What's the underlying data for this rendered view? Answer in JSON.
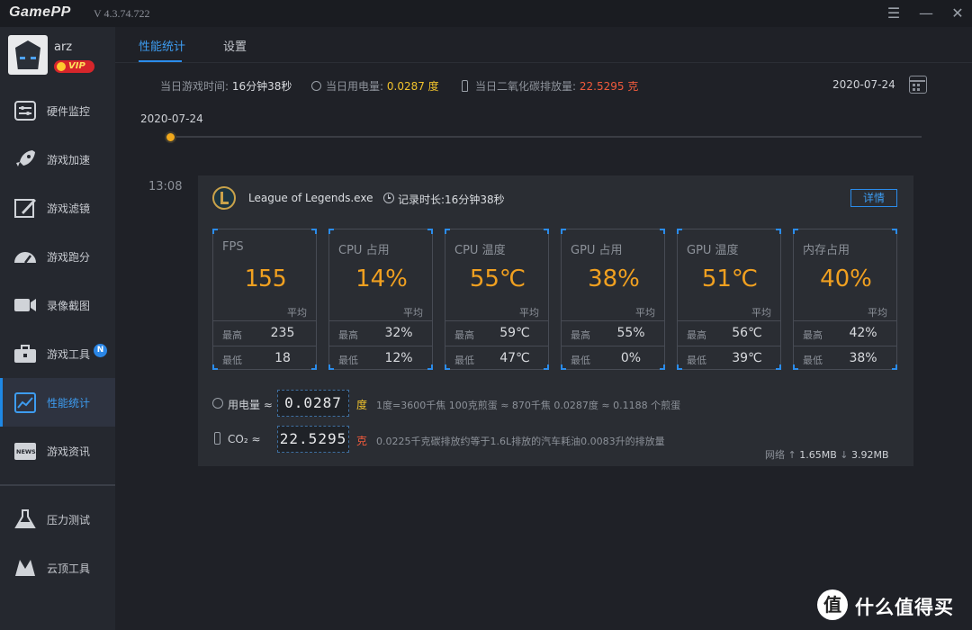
{
  "app": {
    "logo": "GamePP",
    "version": "V 4.3.74.722"
  },
  "window": {
    "menu_icon": "☰",
    "minimize_icon": "—",
    "close_icon": "✕"
  },
  "profile": {
    "username": "arz",
    "vip": "VIP"
  },
  "sidebar": {
    "items": [
      {
        "label": "硬件监控",
        "icon": "hardware-monitor-icon"
      },
      {
        "label": "游戏加速",
        "icon": "rocket-icon"
      },
      {
        "label": "游戏滤镜",
        "icon": "filter-icon"
      },
      {
        "label": "游戏跑分",
        "icon": "speedometer-icon"
      },
      {
        "label": "录像截图",
        "icon": "camera-icon"
      },
      {
        "label": "游戏工具",
        "icon": "toolbox-icon",
        "badge": "N"
      },
      {
        "label": "性能统计",
        "icon": "chart-icon",
        "active": true
      },
      {
        "label": "游戏资讯",
        "icon": "news-icon"
      },
      {
        "label": "压力测试",
        "icon": "flask-icon"
      },
      {
        "label": "云顶工具",
        "icon": "tft-icon"
      }
    ]
  },
  "tabs": [
    {
      "label": "性能统计",
      "active": true
    },
    {
      "label": "设置",
      "active": false
    }
  ],
  "stats": {
    "playtime_label": "当日游戏时间:",
    "playtime_value": "16分钟38秒",
    "power_label": "当日用电量:",
    "power_value": "0.0287 度",
    "co2_label": "当日二氧化碳排放量:",
    "co2_value": "22.5295 克",
    "date": "2020-07-24"
  },
  "timeline": {
    "date": "2020-07-24"
  },
  "session": {
    "time": "13:08",
    "game": "League of Legends.exe",
    "duration": "记录时长:16分钟38秒",
    "detail_button": "详情",
    "metrics": [
      {
        "title": "FPS",
        "value": "155",
        "avg": "平均",
        "max_label": "最高",
        "max": "235",
        "min_label": "最低",
        "min": "18"
      },
      {
        "title": "CPU 占用",
        "value": "14%",
        "avg": "平均",
        "max_label": "最高",
        "max": "32%",
        "min_label": "最低",
        "min": "12%"
      },
      {
        "title": "CPU 温度",
        "value": "55℃",
        "avg": "平均",
        "max_label": "最高",
        "max": "59℃",
        "min_label": "最低",
        "min": "47℃"
      },
      {
        "title": "GPU 占用",
        "value": "38%",
        "avg": "平均",
        "max_label": "最高",
        "max": "55%",
        "min_label": "最低",
        "min": "0%"
      },
      {
        "title": "GPU 温度",
        "value": "51℃",
        "avg": "平均",
        "max_label": "最高",
        "max": "56℃",
        "min_label": "最低",
        "min": "39℃"
      },
      {
        "title": "内存占用",
        "value": "40%",
        "avg": "平均",
        "max_label": "最高",
        "max": "42%",
        "min_label": "最低",
        "min": "38%"
      }
    ],
    "power": {
      "label": "用电量 ≈",
      "value": "0.0287",
      "unit": "度",
      "desc": "1度=3600千焦   100克煎蛋 ≈ 870千焦   0.0287度 ≈ 0.1188 个煎蛋"
    },
    "co2": {
      "label": "CO₂ ≈",
      "value": "22.5295",
      "unit": "克",
      "desc": "0.0225千克碳排放约等于1.6L排放的汽车耗油0.0083升的排放量"
    },
    "network": {
      "label": "网络",
      "up": "1.65MB",
      "down": "3.92MB"
    }
  },
  "watermark": {
    "logo": "值",
    "text": "什么值得买"
  },
  "colors": {
    "accent": "#2b8ceb",
    "value_orange": "#f0a020",
    "power_yellow": "#f0c22c",
    "co2_red": "#f05a3c"
  }
}
